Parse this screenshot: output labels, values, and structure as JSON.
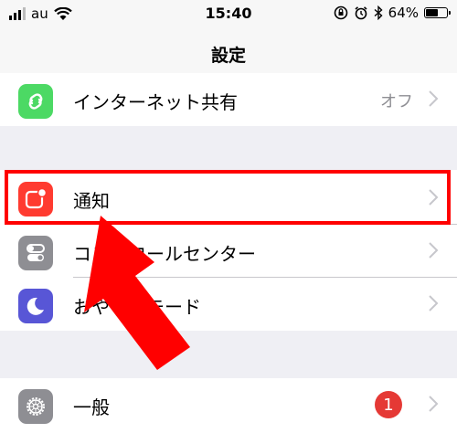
{
  "status_bar": {
    "carrier": "au",
    "time": "15:40",
    "battery_text": "64%",
    "battery_level": 0.64,
    "icons": [
      "signal-icon",
      "wifi-icon",
      "orientation-lock-icon",
      "alarm-icon",
      "bluetooth-icon",
      "battery-icon"
    ]
  },
  "nav": {
    "title": "設定"
  },
  "rows": {
    "hotspot": {
      "label": "インターネット共有",
      "value": "オフ",
      "icon_color": "#4cd964"
    },
    "notifications": {
      "label": "通知",
      "icon_color": "#ff3b30"
    },
    "control_center": {
      "label": "コントロールセンター",
      "icon_color": "#8e8e93"
    },
    "dnd": {
      "label": "おやすみモード",
      "icon_color": "#5856d6"
    },
    "general": {
      "label": "一般",
      "badge": "1",
      "icon_color": "#8e8e93"
    }
  },
  "annotations": {
    "highlight_color": "#ff0000",
    "arrow_color": "#ff0000"
  }
}
